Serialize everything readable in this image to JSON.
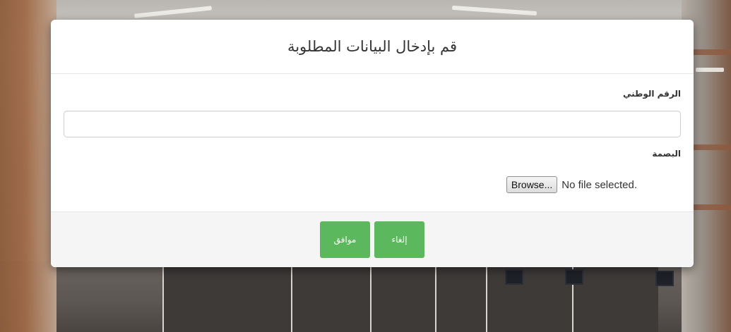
{
  "modal": {
    "title": "قم بإدخال البيانات المطلوبة",
    "fields": {
      "national_id": {
        "label": "الرقم الوطني",
        "value": "",
        "placeholder": ""
      },
      "fingerprint": {
        "label": "البصمة",
        "browse_label": "Browse...",
        "file_status": "No file selected."
      }
    },
    "buttons": {
      "ok": "موافق",
      "cancel": "إلغاء"
    }
  },
  "colors": {
    "button_green": "#5cb85c",
    "modal_bg": "#ffffff",
    "footer_bg": "#f5f5f5"
  }
}
